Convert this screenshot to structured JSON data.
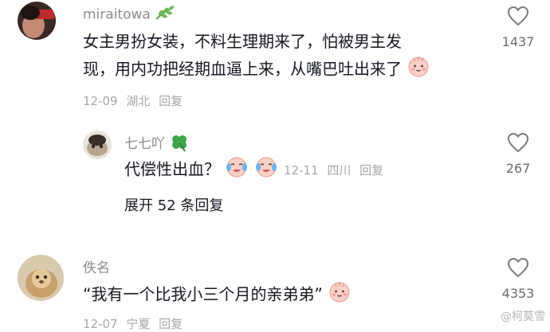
{
  "comments": [
    {
      "username": "miraitowa",
      "username_icon": "leaf-icon",
      "line1": "女主男扮女装，不料生理期来了，怕被男主发",
      "line2": "现，用内功把经期血逼上来，从嘴巴吐出来了",
      "emoji": "blushing-face-emoji",
      "date": "12-09",
      "location": "湖北",
      "reply_label": "回复",
      "likes": "1437"
    },
    {
      "username": "七七吖",
      "username_icon": "clover-icon",
      "text": "代偿性出血？",
      "emoji": "crying-laughing-emoji",
      "date": "12-11",
      "location": "四川",
      "reply_label": "回复",
      "likes": "267"
    },
    {
      "username": "佚名",
      "text": "“我有一个比我小三个月的亲弟弟”",
      "emoji": "blushing-face-emoji",
      "date": "12-07",
      "location": "宁夏",
      "reply_label": "回复",
      "likes": "4353"
    }
  ],
  "expand_replies": "展开 52 条回复",
  "watermark": "@柯莫雪"
}
